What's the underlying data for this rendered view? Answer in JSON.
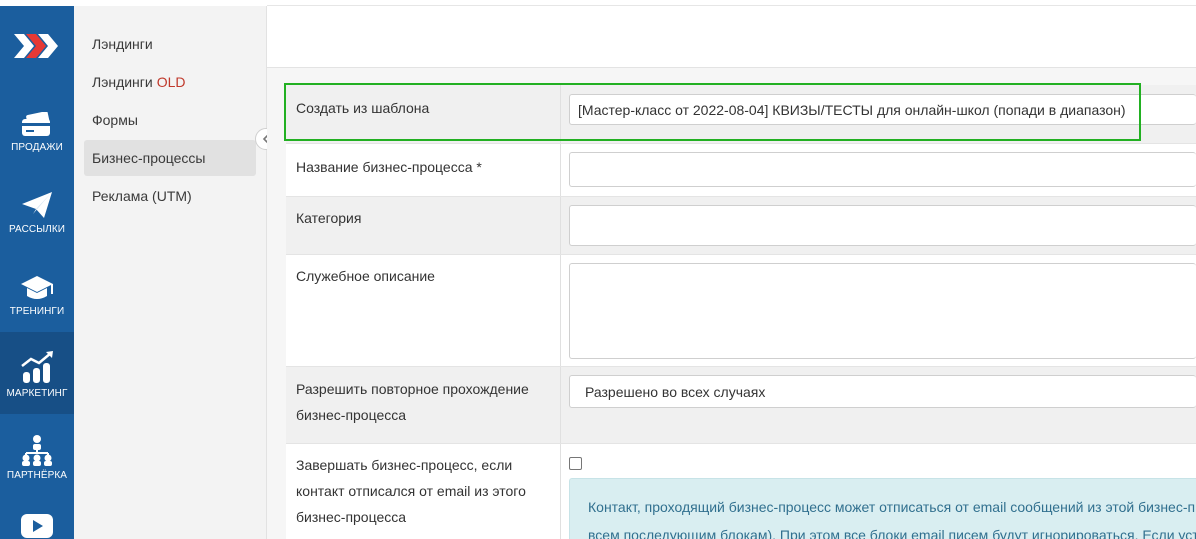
{
  "rail": {
    "items": [
      {
        "label": "ПРОДАЖИ",
        "icon": "wallet-icon"
      },
      {
        "label": "РАССЫЛКИ",
        "icon": "paper-plane-icon"
      },
      {
        "label": "ТРЕНИНГИ",
        "icon": "graduation-cap-icon"
      },
      {
        "label": "МАРКЕТИНГ",
        "icon": "growth-chart-icon"
      },
      {
        "label": "ПАРТНЁРКА",
        "icon": "network-icon"
      }
    ],
    "bottom_icon": "play-button-icon"
  },
  "submenu": {
    "items": [
      {
        "label": "Лэндинги"
      },
      {
        "label": "Лэндинги",
        "suffix": "OLD"
      },
      {
        "label": "Формы"
      },
      {
        "label": "Бизнес-процессы"
      },
      {
        "label": "Реклама (UTM)"
      }
    ]
  },
  "form": {
    "template_label": "Создать из шаблона",
    "template_value": "[Мастер-класс от 2022-08-04] КВИЗЫ/ТЕСТЫ для онлайн-школ (попади в диапазон)",
    "name_label": "Название бизнес-процесса *",
    "name_value": "",
    "category_label": "Категория",
    "category_value": "",
    "description_label": "Служебное описание",
    "description_value": "",
    "repeat_label_1": "Разрешить повторное прохождение",
    "repeat_label_2": "бизнес-процесса",
    "repeat_value": "Разрешено во всех случаях",
    "finish_label_1": "Завершать бизнес-процесс, если",
    "finish_label_2": "контакт отписался от email из этого",
    "finish_label_3": "бизнес-процесса",
    "finish_checked": false,
    "info_line_1": "Контакт, проходящий бизнес-процесс может отписаться от email сообщений из этой бизнес-п",
    "info_line_2": "всем последующим блокам). При этом все блоки email писем будут игнорироваться. Если уста"
  },
  "colors": {
    "rail": "#1b5e9e",
    "highlight": "#22b022",
    "info_bg": "#d9eef1",
    "old_badge": "#c0392b"
  }
}
